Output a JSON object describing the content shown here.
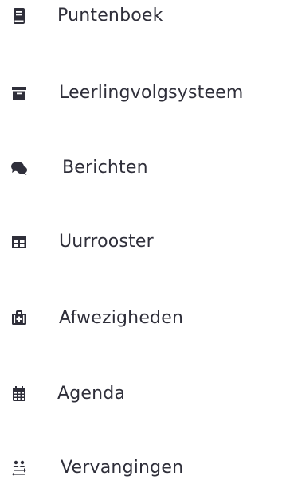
{
  "nav": {
    "items": [
      {
        "label": "Puntenboek",
        "icon": "book-icon"
      },
      {
        "label": "Leerlingvolgsysteem",
        "icon": "archive-box-icon"
      },
      {
        "label": "Berichten",
        "icon": "chat-bubbles-icon"
      },
      {
        "label": "Uurrooster",
        "icon": "table-grid-icon"
      },
      {
        "label": "Afwezigheden",
        "icon": "medical-kit-icon"
      },
      {
        "label": "Agenda",
        "icon": "calendar-icon"
      },
      {
        "label": "Vervangingen",
        "icon": "swap-users-icon"
      }
    ],
    "icon_color": "#2f2f3a"
  }
}
